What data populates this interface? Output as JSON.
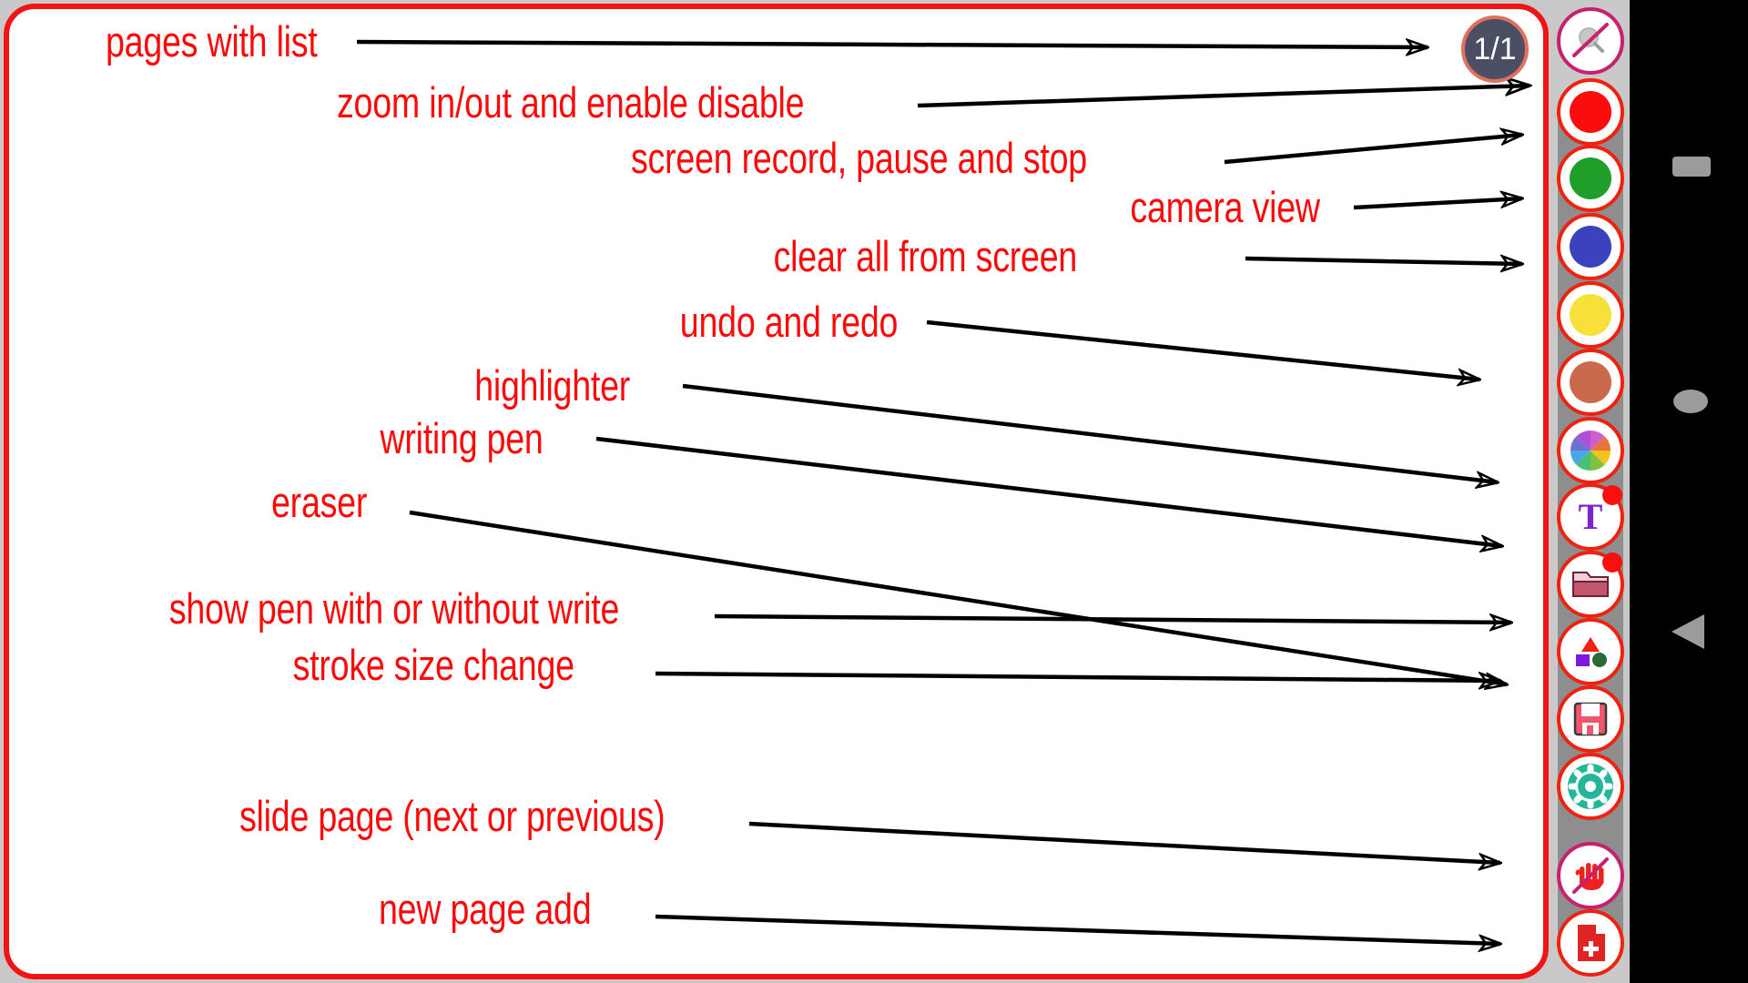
{
  "app": {
    "name": "whiteboard-annotation-screenshot",
    "canvas_bg": "#ffffff",
    "canvas_border_color": "#f21414",
    "annotation_text_color": "#fb0a0a",
    "annotation_line_color": "#000000",
    "toolbar_bg": "#8e8e8e",
    "strip_bg": "#c9c9c9"
  },
  "page_indicator": {
    "label": "1/1",
    "bg": "#4b4f63",
    "border": "#e2705f"
  },
  "annotations": [
    {
      "id": "pages-with-list",
      "text": "pages with list"
    },
    {
      "id": "zoom-enable-disable",
      "text": "zoom in/out and enable disable"
    },
    {
      "id": "screen-record",
      "text": "screen record, pause and stop"
    },
    {
      "id": "camera-view",
      "text": "camera view"
    },
    {
      "id": "clear-all",
      "text": "clear all from screen"
    },
    {
      "id": "undo-redo",
      "text": "undo and redo"
    },
    {
      "id": "highlighter",
      "text": "highlighter"
    },
    {
      "id": "writing-pen",
      "text": "writing pen"
    },
    {
      "id": "eraser",
      "text": "eraser"
    },
    {
      "id": "show-pen",
      "text": "show pen with or without write"
    },
    {
      "id": "stroke-size",
      "text": "stroke size change"
    },
    {
      "id": "slide-page",
      "text": "slide page (next or previous)"
    },
    {
      "id": "new-page-add",
      "text": "new page add"
    }
  ],
  "toolbar": {
    "items": [
      {
        "id": "zoom-disabled",
        "icon": "magnifier-disabled-icon",
        "color": "#bdbdbd",
        "ring": "#c7206e",
        "badge": false
      },
      {
        "id": "color-red",
        "icon": "color-swatch-icon",
        "color": "#fb0d0d",
        "ring": "#ee2211",
        "badge": false
      },
      {
        "id": "color-green",
        "icon": "color-swatch-icon",
        "color": "#1f9e29",
        "ring": "#ee2211",
        "badge": false
      },
      {
        "id": "color-blue",
        "icon": "color-swatch-icon",
        "color": "#3a43bc",
        "ring": "#ee2211",
        "badge": false
      },
      {
        "id": "color-yellow",
        "icon": "color-swatch-icon",
        "color": "#f8e03a",
        "ring": "#ee2211",
        "badge": false
      },
      {
        "id": "color-brown",
        "icon": "color-swatch-icon",
        "color": "#c96a4d",
        "ring": "#ee2211",
        "badge": false
      },
      {
        "id": "color-picker",
        "icon": "color-wheel-icon",
        "color": "",
        "ring": "#ee2211",
        "badge": false
      },
      {
        "id": "text-tool",
        "icon": "text-t-icon",
        "color": "#7d22cc",
        "ring": "#ee2211",
        "badge": true
      },
      {
        "id": "folder",
        "icon": "folder-icon",
        "color": "#c2566f",
        "ring": "#ee2211",
        "badge": true
      },
      {
        "id": "shapes",
        "icon": "shapes-icon",
        "color": "",
        "ring": "#ee2211",
        "badge": false
      },
      {
        "id": "save",
        "icon": "floppy-save-icon",
        "color": "#f2556e",
        "ring": "#ee2211",
        "badge": false
      },
      {
        "id": "settings",
        "icon": "gear-icon",
        "color": "#23b79a",
        "ring": "#ee2211",
        "badge": false
      },
      {
        "id": "hand-disabled",
        "icon": "hand-disabled-icon",
        "color": "#ef2222",
        "ring": "#c7206e",
        "badge": false
      },
      {
        "id": "add-page",
        "icon": "document-plus-icon",
        "color": "#e02424",
        "ring": "#ee2211",
        "badge": false
      }
    ]
  },
  "navbar": {
    "recents_label": "recents",
    "home_label": "home",
    "back_label": "back"
  }
}
